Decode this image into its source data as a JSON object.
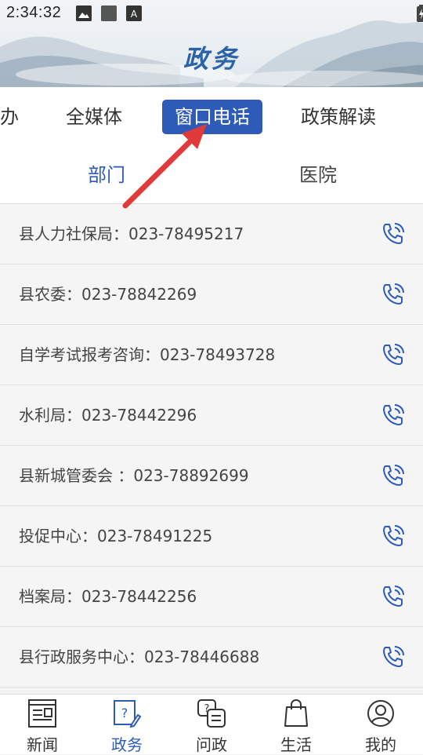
{
  "status_bar": {
    "time": "2:34:32",
    "notification_icons": [
      "image-icon",
      "square-icon",
      "font-a-icon"
    ],
    "system_icons": [
      "wifi-icon",
      "signal-icon",
      "battery-icon"
    ]
  },
  "header": {
    "title": "政务"
  },
  "tabs": [
    {
      "label": "办",
      "active": false
    },
    {
      "label": "全媒体",
      "active": false
    },
    {
      "label": "窗口电话",
      "active": true
    },
    {
      "label": "政策解读",
      "active": false
    }
  ],
  "subtabs": [
    {
      "label": "部门",
      "active": true
    },
    {
      "label": "医院",
      "active": false
    }
  ],
  "contacts": [
    {
      "text": "县人力社保局：023-78495217"
    },
    {
      "text": "县农委：023-78842269"
    },
    {
      "text": "自学考试报考咨询：023-78493728"
    },
    {
      "text": "水利局：023-78442296"
    },
    {
      "text": "县新城管委会 ：023-78892699"
    },
    {
      "text": "投促中心：023-78491225"
    },
    {
      "text": "档案局：023-78442256"
    },
    {
      "text": "县行政服务中心：023-78446688"
    }
  ],
  "bottom_nav": [
    {
      "label": "新闻",
      "icon": "newspaper-icon",
      "active": false
    },
    {
      "label": "政务",
      "icon": "question-edit-icon",
      "active": true
    },
    {
      "label": "问政",
      "icon": "chat-question-icon",
      "active": false
    },
    {
      "label": "生活",
      "icon": "shopping-bag-icon",
      "active": false
    },
    {
      "label": "我的",
      "icon": "user-icon",
      "active": false
    }
  ],
  "colors": {
    "accent": "#2e5bb8",
    "title": "#2a63a6",
    "annotation_arrow": "#e03a3a"
  }
}
